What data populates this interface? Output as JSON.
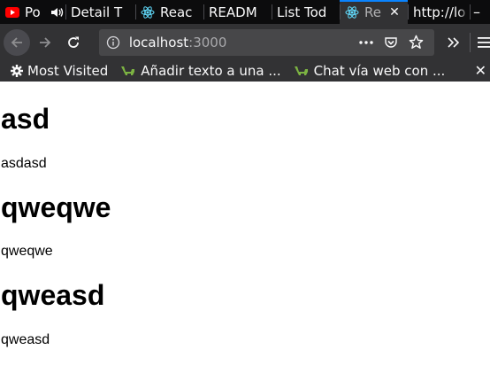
{
  "browser": {
    "tabs": [
      {
        "label": "Po",
        "icon": "youtube-icon",
        "active": false
      },
      {
        "label": "Detail T",
        "icon": "",
        "active": false
      },
      {
        "label": "Reac",
        "icon": "react-icon",
        "active": false
      },
      {
        "label": "READM",
        "icon": "",
        "active": false
      },
      {
        "label": "List Tod",
        "icon": "",
        "active": false
      },
      {
        "label": "Re",
        "icon": "react-icon",
        "active": true
      },
      {
        "label": "http://lo",
        "icon": "",
        "active": false
      }
    ],
    "url_host": "localhost",
    "url_port": ":3000",
    "bookmarks": [
      {
        "label": "Most Visited",
        "icon": "gear-icon"
      },
      {
        "label": "Añadir texto a una ...",
        "icon": "dino-icon"
      },
      {
        "label": "Chat vía web con ...",
        "icon": "dino-icon"
      }
    ],
    "accent_color": "#0a84ff"
  },
  "posts": [
    {
      "title": "asd",
      "body": "asdasd"
    },
    {
      "title": "qweqwe",
      "body": "qweqwe"
    },
    {
      "title": "qweasd",
      "body": "qweasd"
    }
  ]
}
